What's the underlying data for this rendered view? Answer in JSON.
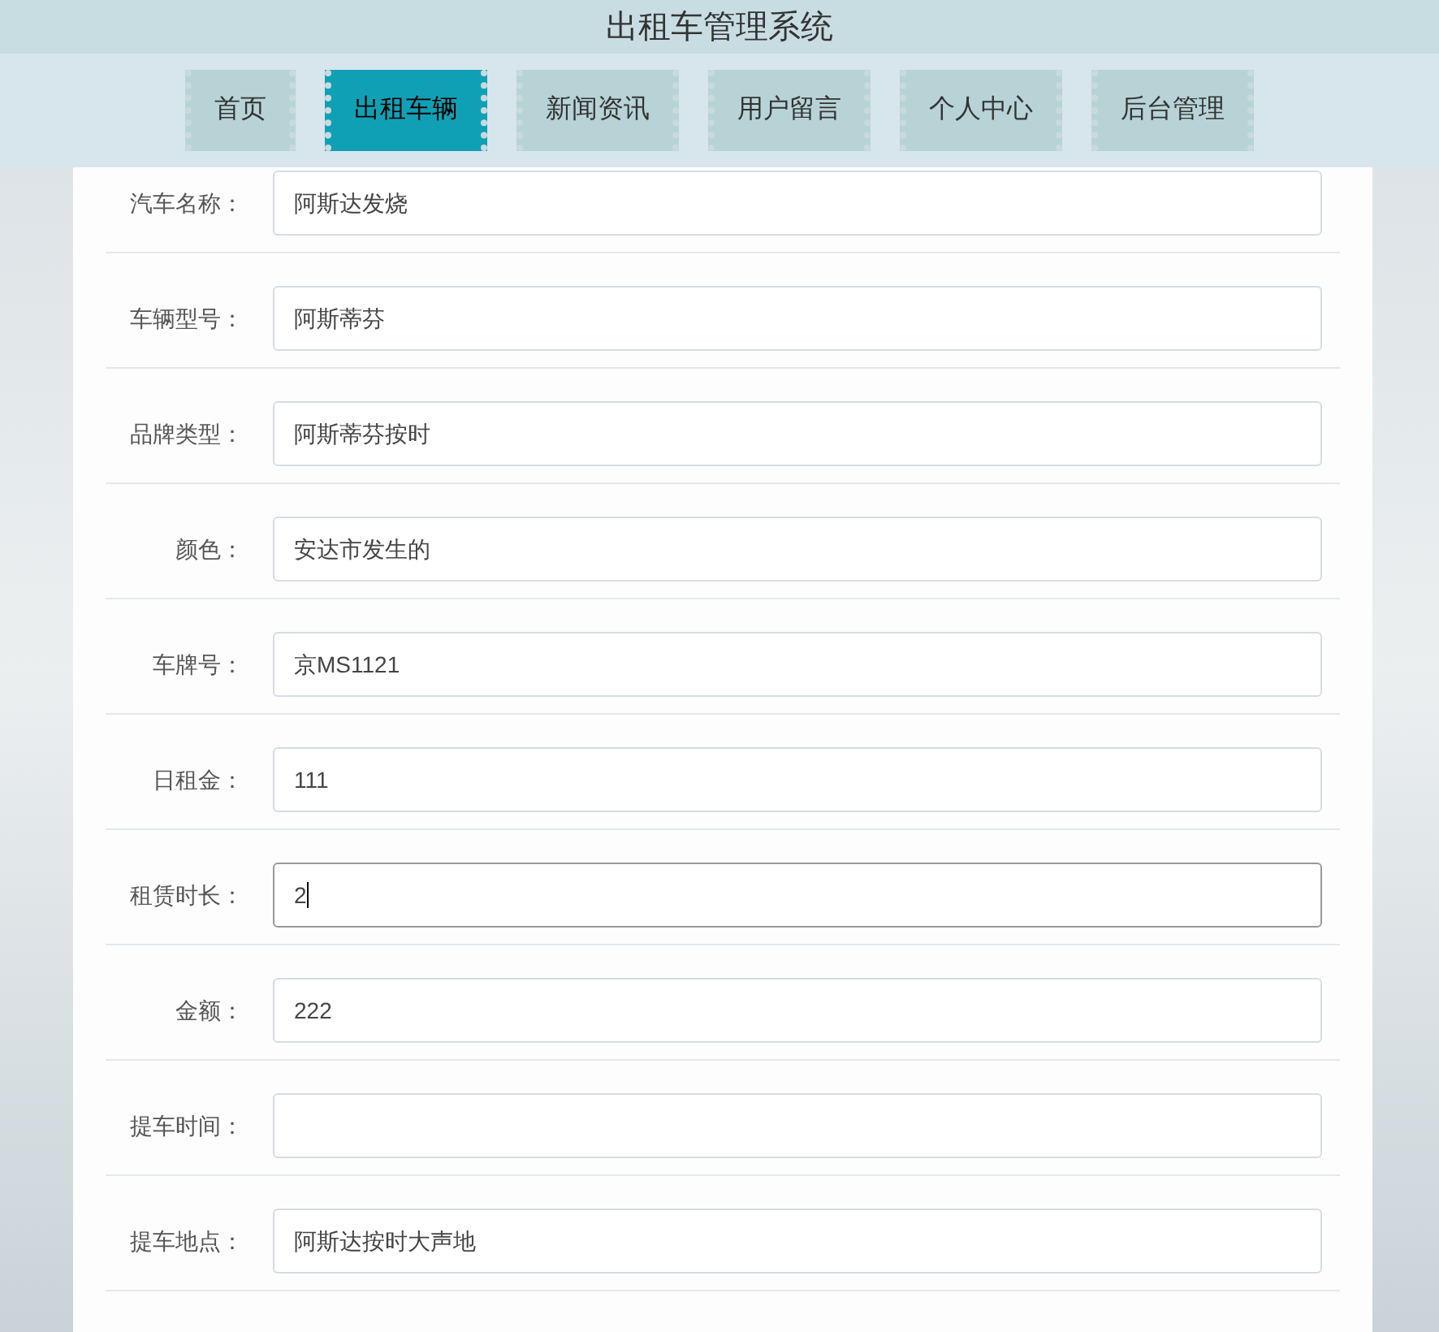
{
  "header": {
    "title": "出租车管理系统"
  },
  "nav": [
    {
      "label": "首页",
      "selected": false
    },
    {
      "label": "出租车辆",
      "selected": true
    },
    {
      "label": "新闻资讯",
      "selected": false
    },
    {
      "label": "用户留言",
      "selected": false
    },
    {
      "label": "个人中心",
      "selected": false
    },
    {
      "label": "后台管理",
      "selected": false
    }
  ],
  "form": [
    {
      "label": "汽车名称：",
      "value": "阿斯达发烧",
      "focused": false
    },
    {
      "label": "车辆型号：",
      "value": "阿斯蒂芬",
      "focused": false
    },
    {
      "label": "品牌类型：",
      "value": "阿斯蒂芬按时",
      "focused": false
    },
    {
      "label": "颜色：",
      "value": "安达市发生的",
      "focused": false
    },
    {
      "label": "车牌号：",
      "value": "京MS1121",
      "focused": false
    },
    {
      "label": "日租金：",
      "value": "111",
      "focused": false
    },
    {
      "label": "租赁时长：",
      "value": "2",
      "focused": true
    },
    {
      "label": "金额：",
      "value": "222",
      "focused": false
    },
    {
      "label": "提车时间：",
      "focused": false
    },
    {
      "label": "提车地点：",
      "value": "阿斯达按时大声地",
      "focused": false
    }
  ]
}
